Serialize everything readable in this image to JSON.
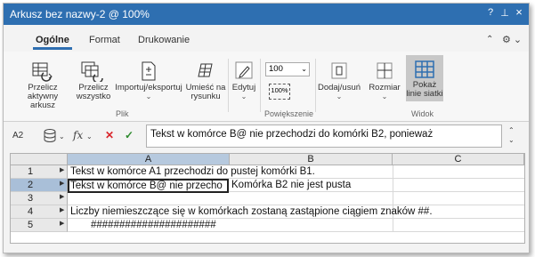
{
  "window": {
    "title": "Arkusz bez nazwy-2 @ 100%",
    "help_label": "?",
    "pin_label": "⊥",
    "close_label": "×"
  },
  "ribbon_tabs": [
    {
      "label": "Ogólne",
      "active": true
    },
    {
      "label": "Format",
      "active": false
    },
    {
      "label": "Drukowanie",
      "active": false
    }
  ],
  "ribbon": {
    "buttons": {
      "recalc_sheet": "Przelicz aktywny arkusz",
      "recalc_all": "Przelicz wszystko",
      "import_export": "Importuj/eksportuj",
      "place_in_drawing": "Umieść na rysunku",
      "editing": "Edytuj",
      "add_remove": "Dodaj/usuń",
      "size": "Rozmiar",
      "show_gridlines": "Pokaż linie siatki"
    },
    "zoom_value": "100",
    "zoom_100_label": "100%",
    "groups": {
      "file": "Plik",
      "zoom": "Powiększenie",
      "view": "Widok"
    }
  },
  "formula_bar": {
    "cell_ref": "A2",
    "fx_label": "fx",
    "cancel_label": "✕",
    "accept_label": "✓",
    "value": "Tekst w komórce B@ nie przechodzi do komórki B2, ponieważ"
  },
  "sheet": {
    "columns": [
      "A",
      "B",
      "C"
    ],
    "rows": [
      "1",
      "2",
      "3",
      "4",
      "5"
    ],
    "cells": {
      "A1": "Tekst w komórce A1 przechodzi do pustej komórki B1.",
      "A2": "Tekst w komórce B@ nie przecho",
      "B2": "Komórka B2 nie jest pusta",
      "A4": "Liczby niemieszczące się w komórkach zostaną zastąpione ciągiem znaków ##.",
      "A5": "######################"
    }
  },
  "colors": {
    "accent": "#2e6fb1",
    "selected_header": "#b6c9de",
    "cancel": "#d9262c",
    "accept": "#2d8a2d"
  }
}
